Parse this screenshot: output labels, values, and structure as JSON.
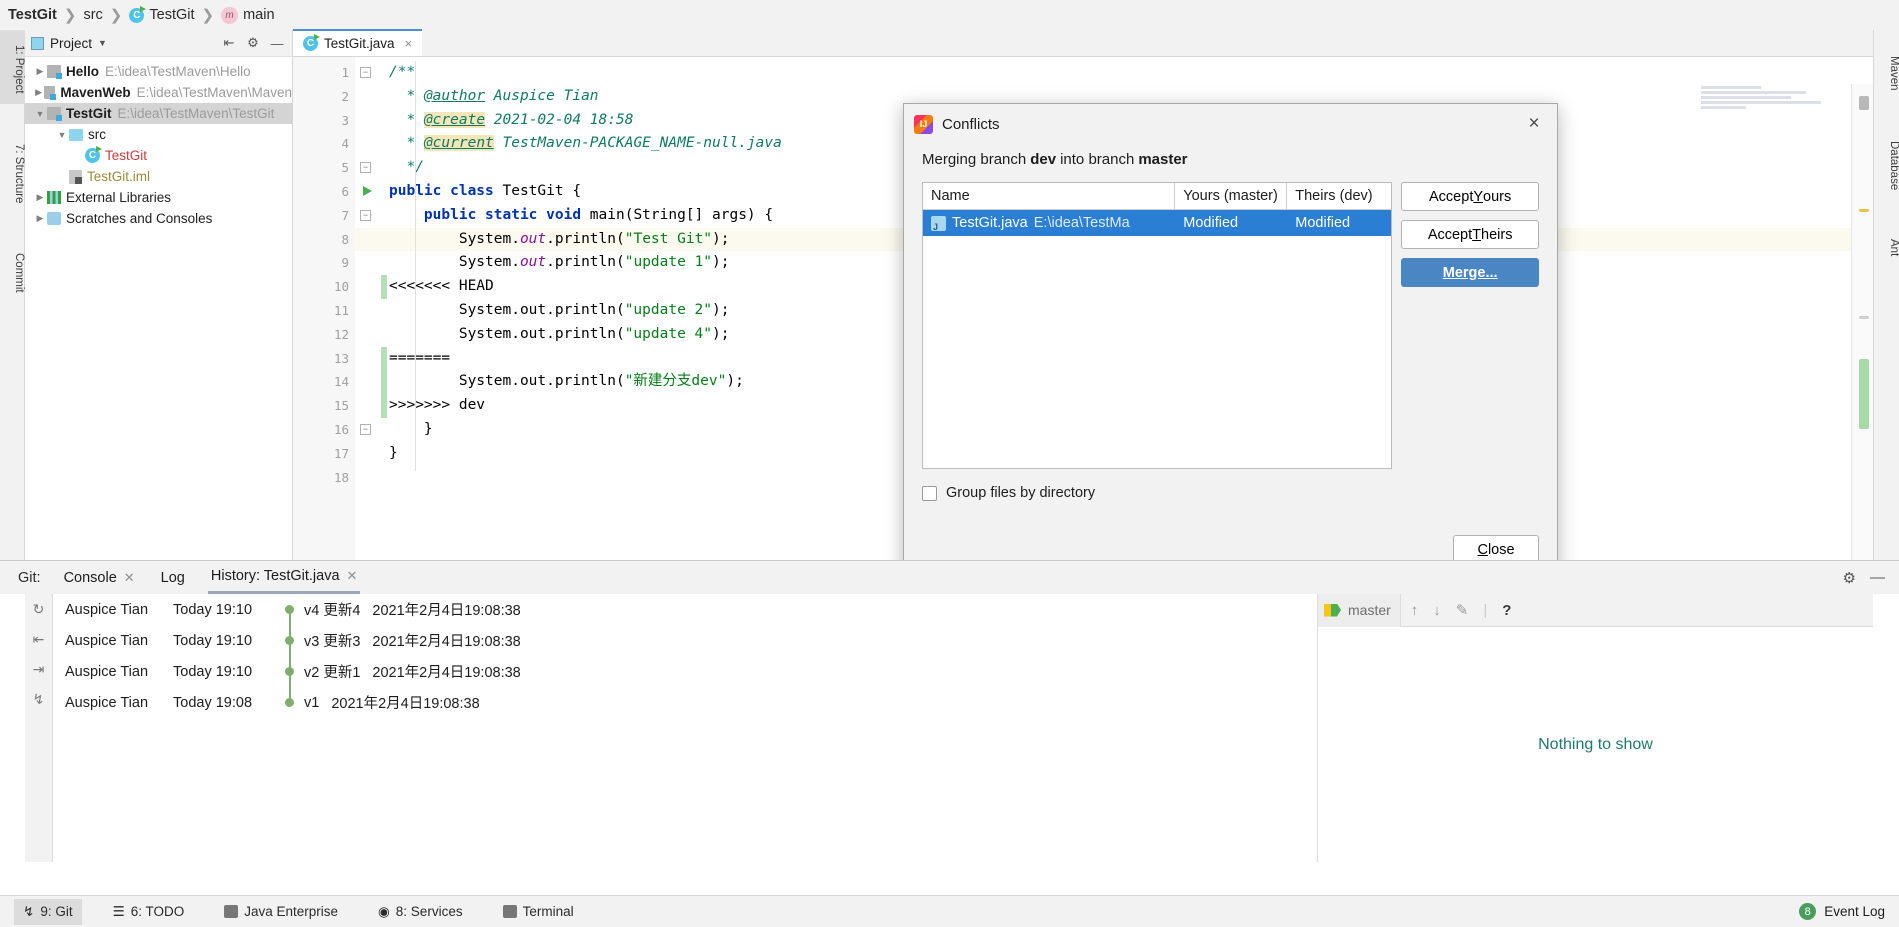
{
  "breadcrumb": {
    "items": [
      {
        "label": "TestGit",
        "bold": true,
        "icon": "none"
      },
      {
        "label": "src",
        "bold": false,
        "icon": "none"
      },
      {
        "label": "TestGit",
        "bold": false,
        "icon": "class-icon"
      },
      {
        "label": "main",
        "bold": false,
        "icon": "method-icon"
      }
    ]
  },
  "left_rail": [
    {
      "label": "1: Project",
      "active": true
    },
    {
      "label": "7: Structure",
      "active": false
    },
    {
      "label": "Commit",
      "active": false
    }
  ],
  "right_rail": [
    {
      "label": "Maven"
    },
    {
      "label": "Database"
    },
    {
      "label": "Ant"
    }
  ],
  "project_panel": {
    "title": "Project",
    "collapse_icon": "collapse-all-icon",
    "settings_icon": "gear-icon",
    "hide_icon": "minimize-icon",
    "tree": [
      {
        "name": "Hello",
        "path": "E:\\idea\\TestMaven\\Hello",
        "arrow": "▶",
        "icon": "module-icon",
        "indent": 0,
        "selected": false,
        "style": "bold"
      },
      {
        "name": "MavenWeb",
        "path": "E:\\idea\\TestMaven\\Maven",
        "arrow": "▶",
        "icon": "module-icon",
        "indent": 0,
        "selected": false,
        "style": "bold"
      },
      {
        "name": "TestGit",
        "path": "E:\\idea\\TestMaven\\TestGit",
        "arrow": "▼",
        "icon": "module-icon",
        "indent": 0,
        "selected": true,
        "style": "bold"
      },
      {
        "name": "src",
        "path": "",
        "arrow": "▼",
        "icon": "folder-icon",
        "indent": 1,
        "selected": false,
        "style": "plain"
      },
      {
        "name": "TestGit",
        "path": "",
        "arrow": "",
        "icon": "class-icon",
        "indent": 2,
        "selected": false,
        "style": "red"
      },
      {
        "name": "TestGit.iml",
        "path": "",
        "arrow": "",
        "icon": "iml-icon",
        "indent": 1,
        "selected": false,
        "style": "olive"
      },
      {
        "name": "External Libraries",
        "path": "",
        "arrow": "▶",
        "icon": "library-icon",
        "indent": 0,
        "selected": false,
        "style": "plain"
      },
      {
        "name": "Scratches and Consoles",
        "path": "",
        "arrow": "▶",
        "icon": "scratch-icon",
        "indent": 0,
        "selected": false,
        "style": "plain"
      }
    ]
  },
  "editor": {
    "tab": {
      "label": "TestGit.java",
      "icon": "class-icon",
      "close": "×"
    },
    "lines": [
      {
        "n": "1",
        "html": "<span class='cmt'>/**</span>",
        "fold": "−",
        "run": false,
        "hl": false,
        "conflict": false
      },
      {
        "n": "2",
        "html": "  <span class='cmt'>* </span><span class='tag-p'>@author</span><span class='cmt'> Auspice Tian</span>",
        "fold": "",
        "run": false,
        "hl": false,
        "conflict": false
      },
      {
        "n": "3",
        "html": "  <span class='cmt'>* </span><span class='tag'>@create</span><span class='cmt'> 2021-02-04 18:58</span>",
        "fold": "",
        "run": false,
        "hl": false,
        "conflict": false
      },
      {
        "n": "4",
        "html": "  <span class='cmt'>* </span><span class='tag'>@current</span><span class='cmt'> TestMaven-PACKAGE_NAME-null.java</span>",
        "fold": "",
        "run": false,
        "hl": false,
        "conflict": false
      },
      {
        "n": "5",
        "html": "  <span class='cmt'>*/</span>",
        "fold": "−",
        "run": false,
        "hl": false,
        "conflict": false
      },
      {
        "n": "6",
        "html": "<span class='kw'>public class</span> TestGit {",
        "fold": "",
        "run": true,
        "hl": false,
        "conflict": false
      },
      {
        "n": "7",
        "html": "    <span class='kw'>public static void</span> main(String[] args) {",
        "fold": "−",
        "run": true,
        "hl": false,
        "conflict": false
      },
      {
        "n": "8",
        "html": "        System.<span class='fld'>out</span>.println(<span class='str'>\"Test Git\"</span>);",
        "fold": "",
        "run": false,
        "hl": true,
        "conflict": false
      },
      {
        "n": "9",
        "html": "        System.<span class='fld'>out</span>.println(<span class='str'>\"update 1\"</span>);",
        "fold": "",
        "run": false,
        "hl": false,
        "conflict": false
      },
      {
        "n": "10",
        "html": "&lt;&lt;&lt;&lt;&lt;&lt;&lt; HEAD",
        "fold": "",
        "run": false,
        "hl": false,
        "conflict": true
      },
      {
        "n": "11",
        "html": "        System.out.println(<span class='str'>\"update 2\"</span>);",
        "fold": "",
        "run": false,
        "hl": false,
        "conflict": false
      },
      {
        "n": "12",
        "html": "        System.out.println(<span class='str'>\"update 4\"</span>);",
        "fold": "",
        "run": false,
        "hl": false,
        "conflict": false
      },
      {
        "n": "13",
        "html": "=======",
        "fold": "",
        "run": false,
        "hl": false,
        "conflict": true
      },
      {
        "n": "14",
        "html": "        System.out.println(<span class='str'>\"新建分支dev\"</span>);",
        "fold": "",
        "run": false,
        "hl": false,
        "conflict": true
      },
      {
        "n": "15",
        "html": "&gt;&gt;&gt;&gt;&gt;&gt;&gt; dev",
        "fold": "",
        "run": false,
        "hl": false,
        "conflict": true
      },
      {
        "n": "16",
        "html": "    }",
        "fold": "−",
        "run": false,
        "hl": false,
        "conflict": false
      },
      {
        "n": "17",
        "html": "}",
        "fold": "",
        "run": false,
        "hl": false,
        "conflict": false
      },
      {
        "n": "18",
        "html": "",
        "fold": "",
        "run": false,
        "hl": false,
        "conflict": false
      }
    ]
  },
  "dialog": {
    "title": "Conflicts",
    "icon": "intellij-icon",
    "close_icon": "×",
    "subtitle_prefix": "Merging branch",
    "subtitle_branch_from": "dev",
    "subtitle_mid": "into branch",
    "subtitle_branch_to": "master",
    "columns": [
      "Name",
      "Yours (master)",
      "Theirs (dev)"
    ],
    "rows": [
      {
        "name": "TestGit.java",
        "path": "E:\\idea\\TestMa",
        "yours": "Modified",
        "theirs": "Modified",
        "selected": true,
        "icon": "java-file-icon"
      }
    ],
    "buttons": [
      {
        "label": "Accept Yours",
        "mnemonic": "Y",
        "primary": false
      },
      {
        "label": "Accept Theirs",
        "mnemonic": "T",
        "primary": false
      },
      {
        "label": "Merge...",
        "mnemonic": "M",
        "primary": true
      }
    ],
    "group_checkbox": {
      "label": "Group files by directory",
      "checked": false
    },
    "close_button": {
      "label": "Close",
      "mnemonic": "C"
    }
  },
  "git_panel": {
    "label": "Git:",
    "tabs": [
      {
        "label": "Console",
        "closable": true,
        "active": false
      },
      {
        "label": "Log",
        "closable": false,
        "active": false
      },
      {
        "label": "History: TestGit.java",
        "closable": true,
        "active": true
      }
    ],
    "tool_icons": [
      "gear-icon",
      "minimize-icon"
    ],
    "rail_icons": [
      "refresh-icon",
      "collapse-left-icon",
      "collapse-icon",
      "branch-icon"
    ],
    "commits": [
      {
        "author": "Auspice Tian",
        "time": "Today 19:10",
        "message": "v4 更新4",
        "date": "2021年2月4日19:08:38"
      },
      {
        "author": "Auspice Tian",
        "time": "Today 19:10",
        "message": "v3 更新3",
        "date": "2021年2月4日19:08:38"
      },
      {
        "author": "Auspice Tian",
        "time": "Today 19:10",
        "message": "v2 更新1",
        "date": "2021年2月4日19:08:38"
      },
      {
        "author": "Auspice Tian",
        "time": "Today 19:08",
        "message": "v1",
        "date": "2021年2月4日19:08:38"
      }
    ],
    "detail": {
      "branch": "master",
      "branch_icon": "tag-icon",
      "tools": [
        "arrow-up-icon",
        "arrow-down-icon",
        "edit-icon",
        "help-icon"
      ],
      "empty_text": "Nothing to show"
    }
  },
  "status_bar": {
    "items": [
      {
        "label": "9: Git",
        "mnemonic": "9",
        "icon": "branch-icon",
        "active": true
      },
      {
        "label": "6: TODO",
        "mnemonic": "6",
        "icon": "list-icon",
        "active": false
      },
      {
        "label": "Java Enterprise",
        "mnemonic": "",
        "icon": "java-ee-icon",
        "active": false
      },
      {
        "label": "8: Services",
        "mnemonic": "8",
        "icon": "play-icon",
        "active": false
      },
      {
        "label": "Terminal",
        "mnemonic": "",
        "icon": "terminal-icon",
        "active": false
      }
    ],
    "event_log": {
      "count": "8",
      "label": "Event Log"
    }
  },
  "colors": {
    "accent": "#4a85c4",
    "selection": "#2a7fd4",
    "conflict_marker": "#b7dfb7",
    "link": "#1f7a6e"
  }
}
